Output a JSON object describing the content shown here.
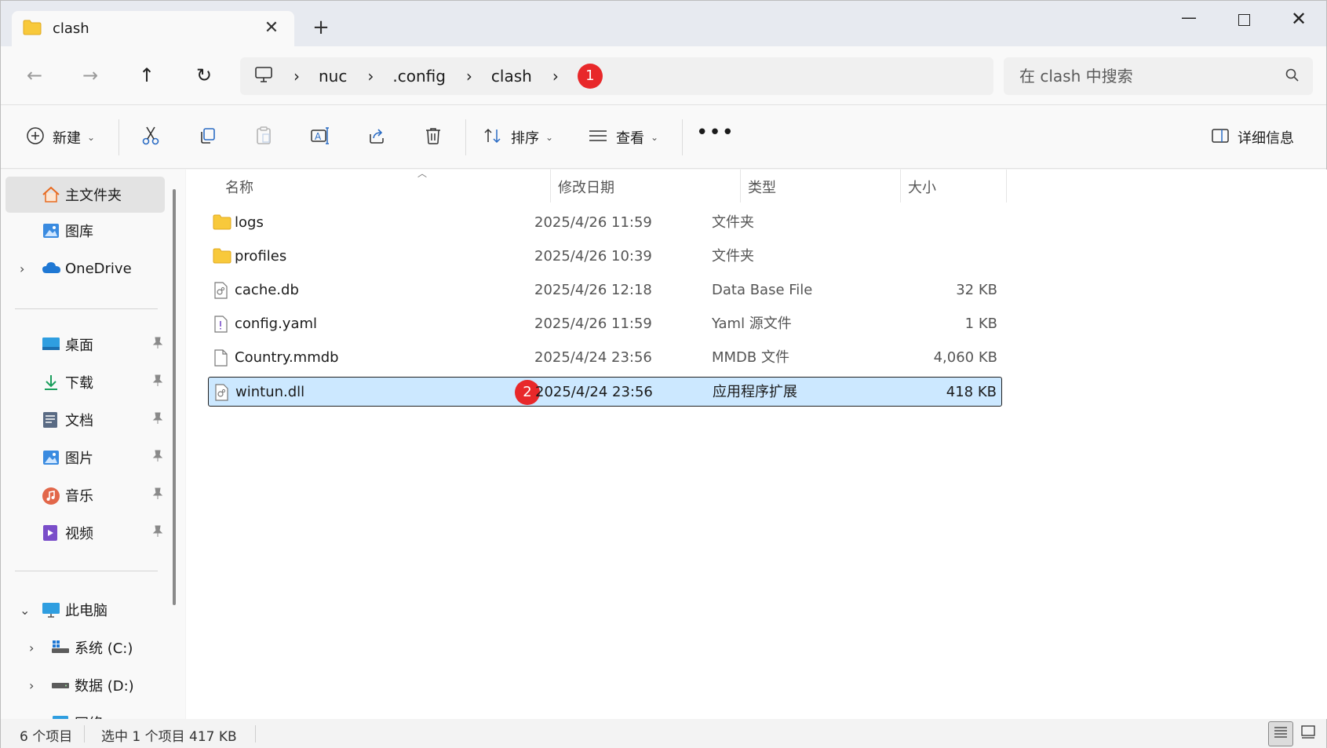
{
  "window": {
    "tab_title": "clash",
    "tab_close_glyph": "✕",
    "new_tab_glyph": "+",
    "minimize_glyph": "—",
    "close_glyph": "✕"
  },
  "nav": {
    "back_glyph": "←",
    "forward_glyph": "→",
    "up_glyph": "↑",
    "refresh_glyph": "↻"
  },
  "breadcrumb": {
    "separator": "›",
    "items": [
      "nuc",
      ".config",
      "clash"
    ],
    "badge": "1"
  },
  "search": {
    "placeholder": "在 clash 中搜索"
  },
  "commands": {
    "new_label": "新建",
    "sort_label": "排序",
    "view_label": "查看",
    "more_glyph": "•••",
    "details_label": "详细信息",
    "dropdown_glyph": "⌄"
  },
  "sidebar": {
    "chevron_right": "›",
    "chevron_down": "⌄",
    "pin_glyph": "📌",
    "top_items": [
      {
        "label": "主文件夹",
        "icon": "home-icon"
      },
      {
        "label": "图库",
        "icon": "gallery-icon"
      },
      {
        "label": "OneDrive",
        "icon": "cloud-icon"
      }
    ],
    "pinned_items": [
      {
        "label": "桌面",
        "icon": "desktop-icon"
      },
      {
        "label": "下载",
        "icon": "download-icon"
      },
      {
        "label": "文档",
        "icon": "document-icon"
      },
      {
        "label": "图片",
        "icon": "pictures-icon"
      },
      {
        "label": "音乐",
        "icon": "music-icon"
      },
      {
        "label": "视频",
        "icon": "video-icon"
      }
    ],
    "this_pc": "此电脑",
    "drives": [
      {
        "label": "系统 (C:)",
        "icon": "system-drive-icon"
      },
      {
        "label": "数据 (D:)",
        "icon": "drive-icon"
      }
    ],
    "partial_item": "网络"
  },
  "columns": {
    "name": "名称",
    "date": "修改日期",
    "type": "类型",
    "size": "大小"
  },
  "files": [
    {
      "name": "logs",
      "date": "2025/4/26 11:59",
      "type": "文件夹",
      "size": "",
      "icon": "folder-icon"
    },
    {
      "name": "profiles",
      "date": "2025/4/26 10:39",
      "type": "文件夹",
      "size": "",
      "icon": "folder-icon"
    },
    {
      "name": "cache.db",
      "date": "2025/4/26 12:18",
      "type": "Data Base File",
      "size": "32 KB",
      "icon": "db-file-icon"
    },
    {
      "name": "config.yaml",
      "date": "2025/4/26 11:59",
      "type": "Yaml 源文件",
      "size": "1 KB",
      "icon": "yaml-file-icon"
    },
    {
      "name": "Country.mmdb",
      "date": "2025/4/24 23:56",
      "type": "MMDB 文件",
      "size": "4,060 KB",
      "icon": "file-icon"
    },
    {
      "name": "wintun.dll",
      "date": "2025/4/24 23:56",
      "type": "应用程序扩展",
      "size": "418 KB",
      "icon": "dll-file-icon",
      "selected": true,
      "badge": "2"
    }
  ],
  "status": {
    "item_count": "6 个项目",
    "selection": "选中 1 个项目  417 KB"
  },
  "colors": {
    "accent_badge": "#e8282a",
    "selection": "#cce8ff",
    "folder": "#f8c93b"
  }
}
